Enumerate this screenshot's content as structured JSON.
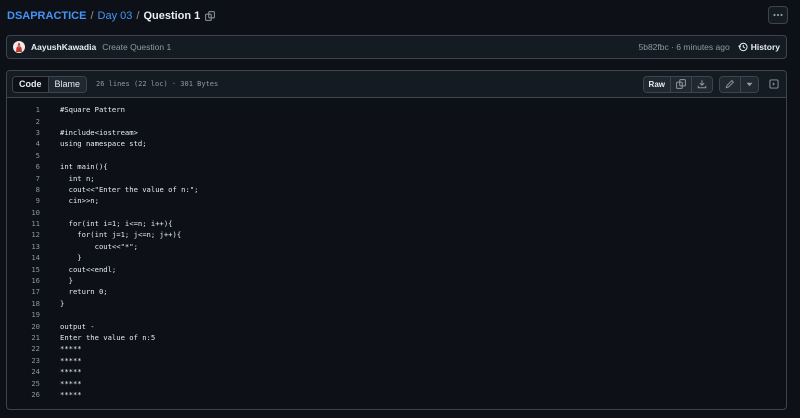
{
  "breadcrumb": {
    "repo": "DSAPRACTICE",
    "sep": "/",
    "folder": "Day 03",
    "file": "Question 1"
  },
  "commit": {
    "author": "AayushKawadia",
    "message": "Create Question 1",
    "meta": "5b82fbc · 6 minutes ago",
    "history_label": "History"
  },
  "file_header": {
    "code_tab": "Code",
    "blame_tab": "Blame",
    "info": "26 lines (22 loc) · 301 Bytes",
    "raw_label": "Raw"
  },
  "code": {
    "lines": [
      {
        "n": "1",
        "t": "#Square Pattern"
      },
      {
        "n": "2",
        "t": ""
      },
      {
        "n": "3",
        "t": "#include<iostream>"
      },
      {
        "n": "4",
        "t": "using namespace std;"
      },
      {
        "n": "5",
        "t": ""
      },
      {
        "n": "6",
        "t": "int main(){"
      },
      {
        "n": "7",
        "t": "  int n;"
      },
      {
        "n": "8",
        "t": "  cout<<\"Enter the value of n:\";"
      },
      {
        "n": "9",
        "t": "  cin>>n;"
      },
      {
        "n": "10",
        "t": ""
      },
      {
        "n": "11",
        "t": "  for(int i=1; i<=n; i++){"
      },
      {
        "n": "12",
        "t": "    for(int j=1; j<=n; j++){"
      },
      {
        "n": "13",
        "t": "        cout<<\"*\";"
      },
      {
        "n": "14",
        "t": "    }"
      },
      {
        "n": "15",
        "t": "  cout<<endl;"
      },
      {
        "n": "16",
        "t": "  }"
      },
      {
        "n": "17",
        "t": "  return 0;"
      },
      {
        "n": "18",
        "t": "}"
      },
      {
        "n": "19",
        "t": ""
      },
      {
        "n": "20",
        "t": "output -"
      },
      {
        "n": "21",
        "t": "Enter the value of n:5"
      },
      {
        "n": "22",
        "t": "*****"
      },
      {
        "n": "23",
        "t": "*****"
      },
      {
        "n": "24",
        "t": "*****"
      },
      {
        "n": "25",
        "t": "*****"
      },
      {
        "n": "26",
        "t": "*****"
      }
    ]
  },
  "colors": {
    "background": "#0d1117",
    "link": "#4493f8",
    "border": "#3d444d"
  },
  "icons": [
    "copy-icon",
    "kebab-icon",
    "history-icon",
    "download-icon",
    "pencil-icon",
    "triangle-down-icon",
    "symbols-icon"
  ]
}
